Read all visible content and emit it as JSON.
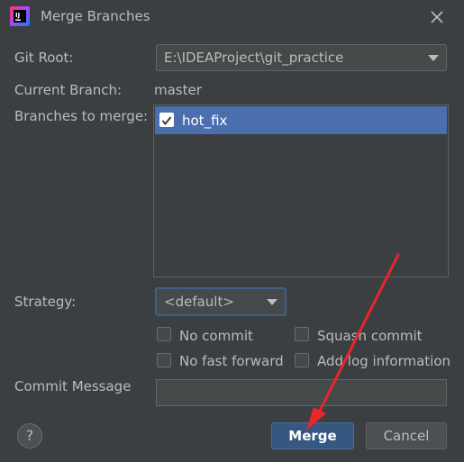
{
  "window": {
    "title": "Merge Branches",
    "app_icon": "intellij-idea-icon",
    "close_icon": "close-icon"
  },
  "form": {
    "git_root_label": "Git Root:",
    "git_root_value": "E:\\IDEAProject\\git_practice",
    "current_branch_label": "Current Branch:",
    "current_branch_value": "master",
    "branches_label": "Branches to merge:",
    "branches": [
      {
        "name": "hot_fix",
        "checked": true,
        "selected": true
      }
    ],
    "strategy_label": "Strategy:",
    "strategy_value": "<default>",
    "options": {
      "no_commit": {
        "label": "No commit",
        "checked": false
      },
      "squash_commit": {
        "label": "Squash commit",
        "checked": false
      },
      "no_fast_forward": {
        "label": "No fast forward",
        "checked": false
      },
      "add_log_information": {
        "label": "Add log information",
        "checked": false
      }
    },
    "commit_message_label": "Commit Message",
    "commit_message_value": ""
  },
  "buttons": {
    "help": "?",
    "merge": "Merge",
    "cancel": "Cancel"
  },
  "colors": {
    "background": "#3c3f41",
    "selection": "#4b6eaf",
    "default_button": "#365880",
    "annotation_arrow": "#e8262b"
  }
}
